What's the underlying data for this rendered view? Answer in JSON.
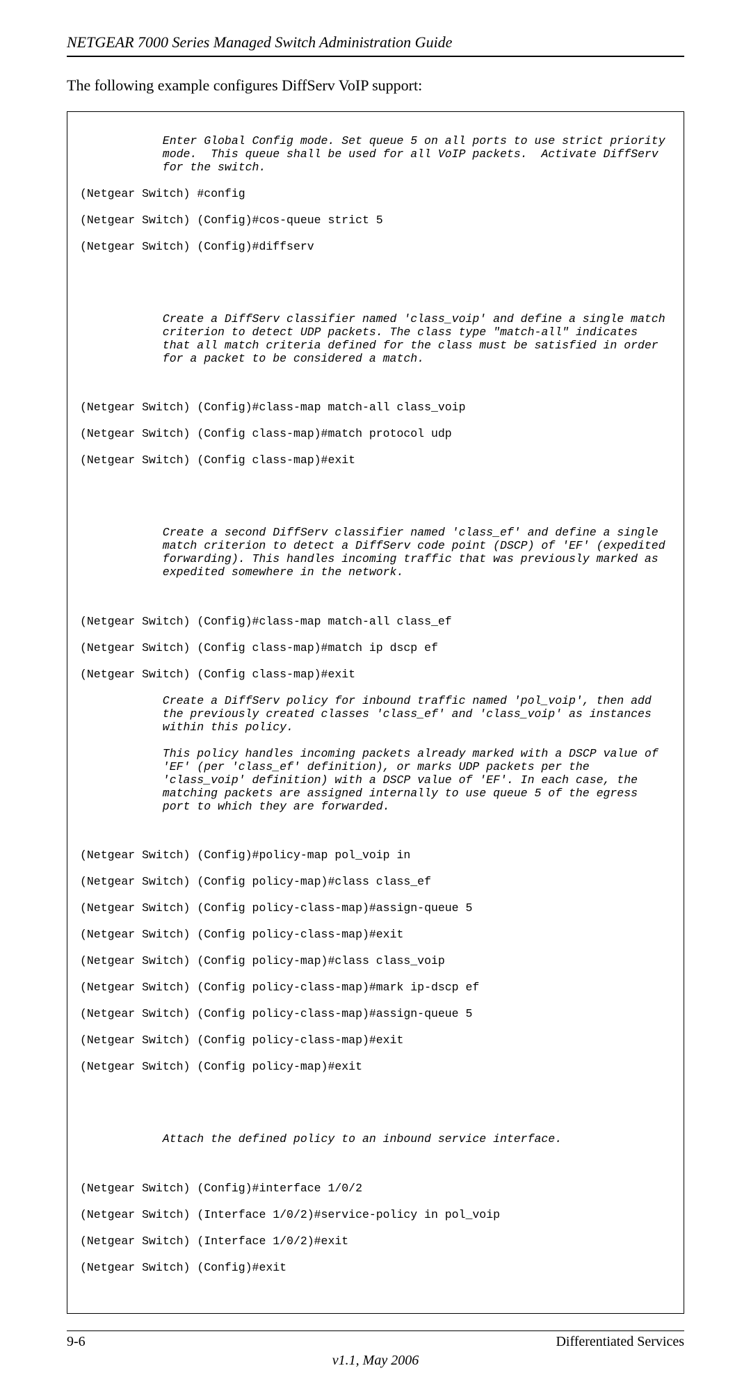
{
  "header": {
    "title": "NETGEAR 7000  Series Managed Switch Administration Guide"
  },
  "intro": "The following example configures DiffServ VoIP support:",
  "code": {
    "comment1": "Enter Global Config mode. Set queue 5 on all ports to use strict priority mode.  This queue shall be used for all VoIP packets.  Activate DiffServ for the switch.",
    "cmd1": "(Netgear Switch) #config",
    "cmd2": "(Netgear Switch) (Config)#cos-queue strict 5",
    "cmd3": "(Netgear Switch) (Config)#diffserv",
    "comment2": "Create a DiffServ classifier named 'class_voip' and define a single match criterion to detect UDP packets. The class type \"match-all\" indicates that all match criteria defined for the class must be satisfied in order for a packet to be considered a match.",
    "cmd4": "(Netgear Switch) (Config)#class-map match-all class_voip",
    "cmd5": "(Netgear Switch) (Config class-map)#match protocol udp",
    "cmd6": "(Netgear Switch) (Config class-map)#exit",
    "comment3": "Create a second DiffServ classifier named 'class_ef' and define a single match criterion to detect a DiffServ code point (DSCP) of 'EF' (expedited forwarding). This handles incoming traffic that was previously marked as expedited somewhere in the network.",
    "cmd7": "(Netgear Switch) (Config)#class-map match-all class_ef",
    "cmd8": "(Netgear Switch) (Config class-map)#match ip dscp ef",
    "cmd9": "(Netgear Switch) (Config class-map)#exit",
    "comment4a": "Create a DiffServ policy for inbound traffic named 'pol_voip', then add the previously created classes 'class_ef' and 'class_voip' as instances within this policy.",
    "comment4b": "This policy handles incoming packets already marked with a DSCP value of 'EF' (per 'class_ef' definition), or marks UDP packets per the 'class_voip' definition) with a DSCP value of 'EF'. In each case, the matching packets are assigned internally to use queue 5 of the egress port to which they are forwarded.",
    "cmd10": "(Netgear Switch) (Config)#policy-map pol_voip in",
    "cmd11": "(Netgear Switch) (Config policy-map)#class class_ef",
    "cmd12": "(Netgear Switch) (Config policy-class-map)#assign-queue 5",
    "cmd13": "(Netgear Switch) (Config policy-class-map)#exit",
    "cmd14": "(Netgear Switch) (Config policy-map)#class class_voip",
    "cmd15": "(Netgear Switch) (Config policy-class-map)#mark ip-dscp ef",
    "cmd16": "(Netgear Switch) (Config policy-class-map)#assign-queue 5",
    "cmd17": "(Netgear Switch) (Config policy-class-map)#exit",
    "cmd18": "(Netgear Switch) (Config policy-map)#exit",
    "comment5": "Attach the defined policy to an inbound service interface.",
    "cmd19": "(Netgear Switch) (Config)#interface 1/0/2",
    "cmd20": "(Netgear Switch) (Interface 1/0/2)#service-policy in pol_voip",
    "cmd21": "(Netgear Switch) (Interface 1/0/2)#exit",
    "cmd22": "(Netgear Switch) (Config)#exit"
  },
  "footer": {
    "page_number": "9-6",
    "section_title": "Differentiated Services",
    "version": "v1.1, May 2006"
  }
}
